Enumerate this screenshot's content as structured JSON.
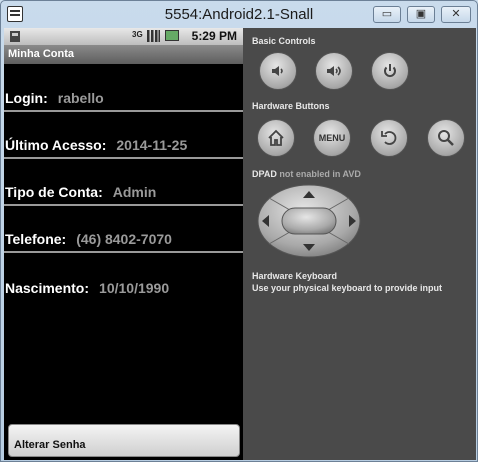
{
  "window": {
    "title": "5554:Android2.1-Snall",
    "min_glyph": "▭",
    "max_glyph": "▣",
    "close_glyph": "✕"
  },
  "statusbar": {
    "network": "3G",
    "time": "5:29 PM"
  },
  "app": {
    "title": "Minha Conta"
  },
  "fields": [
    {
      "label": "Login:",
      "value": "rabello"
    },
    {
      "label": "Último Acesso:",
      "value": "2014-11-25"
    },
    {
      "label": "Tipo de Conta:",
      "value": "Admin"
    },
    {
      "label": "Telefone:",
      "value": "(46) 8402-7070"
    },
    {
      "label": "Nascimento:",
      "value": "10/10/1990"
    }
  ],
  "change_password_button": "Alterar Senha",
  "panel": {
    "basic_controls": "Basic Controls",
    "hardware_buttons": "Hardware Buttons",
    "menu_label": "MENU",
    "dpad_title": "DPAD",
    "dpad_note": "not enabled in AVD",
    "keyboard_title": "Hardware Keyboard",
    "keyboard_note": "Use your physical keyboard to provide input"
  },
  "icons": [
    "volume-down-icon",
    "volume-up-icon",
    "power-icon",
    "home-icon",
    "back-icon",
    "search-icon"
  ]
}
